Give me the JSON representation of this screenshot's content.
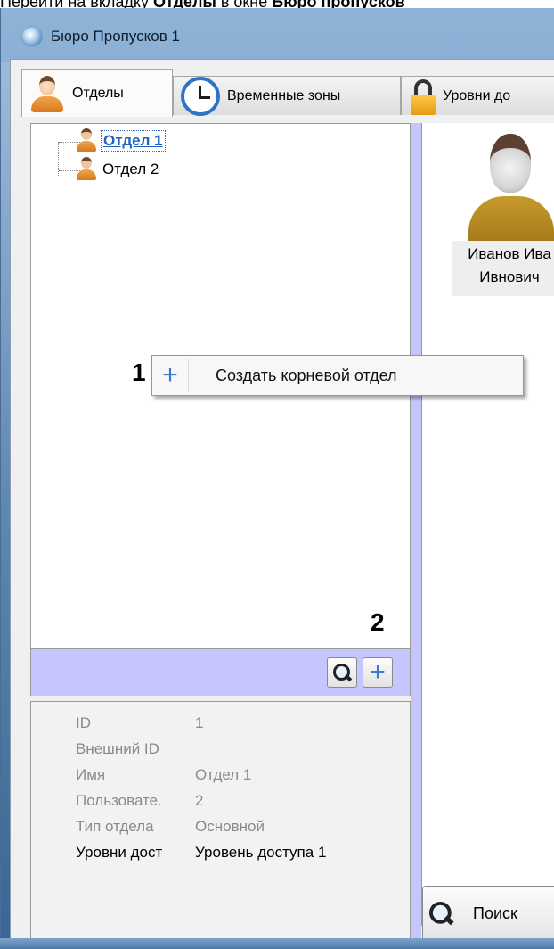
{
  "caption": {
    "prefix": "Перейти на вкладку ",
    "tab_word": "Отделы",
    "middle": " в окне ",
    "window_word": "Бюро пропусков"
  },
  "window": {
    "title": "Бюро Пропусков 1"
  },
  "tabs": [
    {
      "label": "Отделы",
      "icon": "person-icon",
      "active": true
    },
    {
      "label": "Временные зоны",
      "icon": "clock-icon",
      "active": false
    },
    {
      "label": "Уровни до",
      "icon": "lock-icon",
      "active": false
    }
  ],
  "tree": {
    "items": [
      {
        "label": "Отдел 1",
        "selected": true
      },
      {
        "label": "Отдел 2",
        "selected": false
      }
    ]
  },
  "context_menu": {
    "items": [
      {
        "label": "Создать корневой отдел",
        "icon": "plus-icon"
      }
    ]
  },
  "callouts": {
    "one": "1",
    "two": "2"
  },
  "toolbar": {
    "buttons": [
      {
        "icon": "search-icon"
      },
      {
        "icon": "plus-icon"
      }
    ]
  },
  "properties": [
    {
      "key": "ID",
      "value": "1"
    },
    {
      "key": "Внешний ID",
      "value": ""
    },
    {
      "key": "Имя",
      "value": "Отдел 1"
    },
    {
      "key": "Пользовате.",
      "value": "2"
    },
    {
      "key": "Тип отдела",
      "value": "Основной"
    },
    {
      "key": "Уровни дост",
      "value": "Уровень доступа 1"
    }
  ],
  "employees": [
    {
      "name_line1": "Иванов Ива",
      "name_line2": "Ивнович"
    }
  ],
  "search_button": {
    "label": "Поиск",
    "icon": "search-icon"
  },
  "colors": {
    "accent_bar": "#c6c6ff",
    "selection_blue": "#1e63c4",
    "plus_blue": "#3b7ac9"
  }
}
